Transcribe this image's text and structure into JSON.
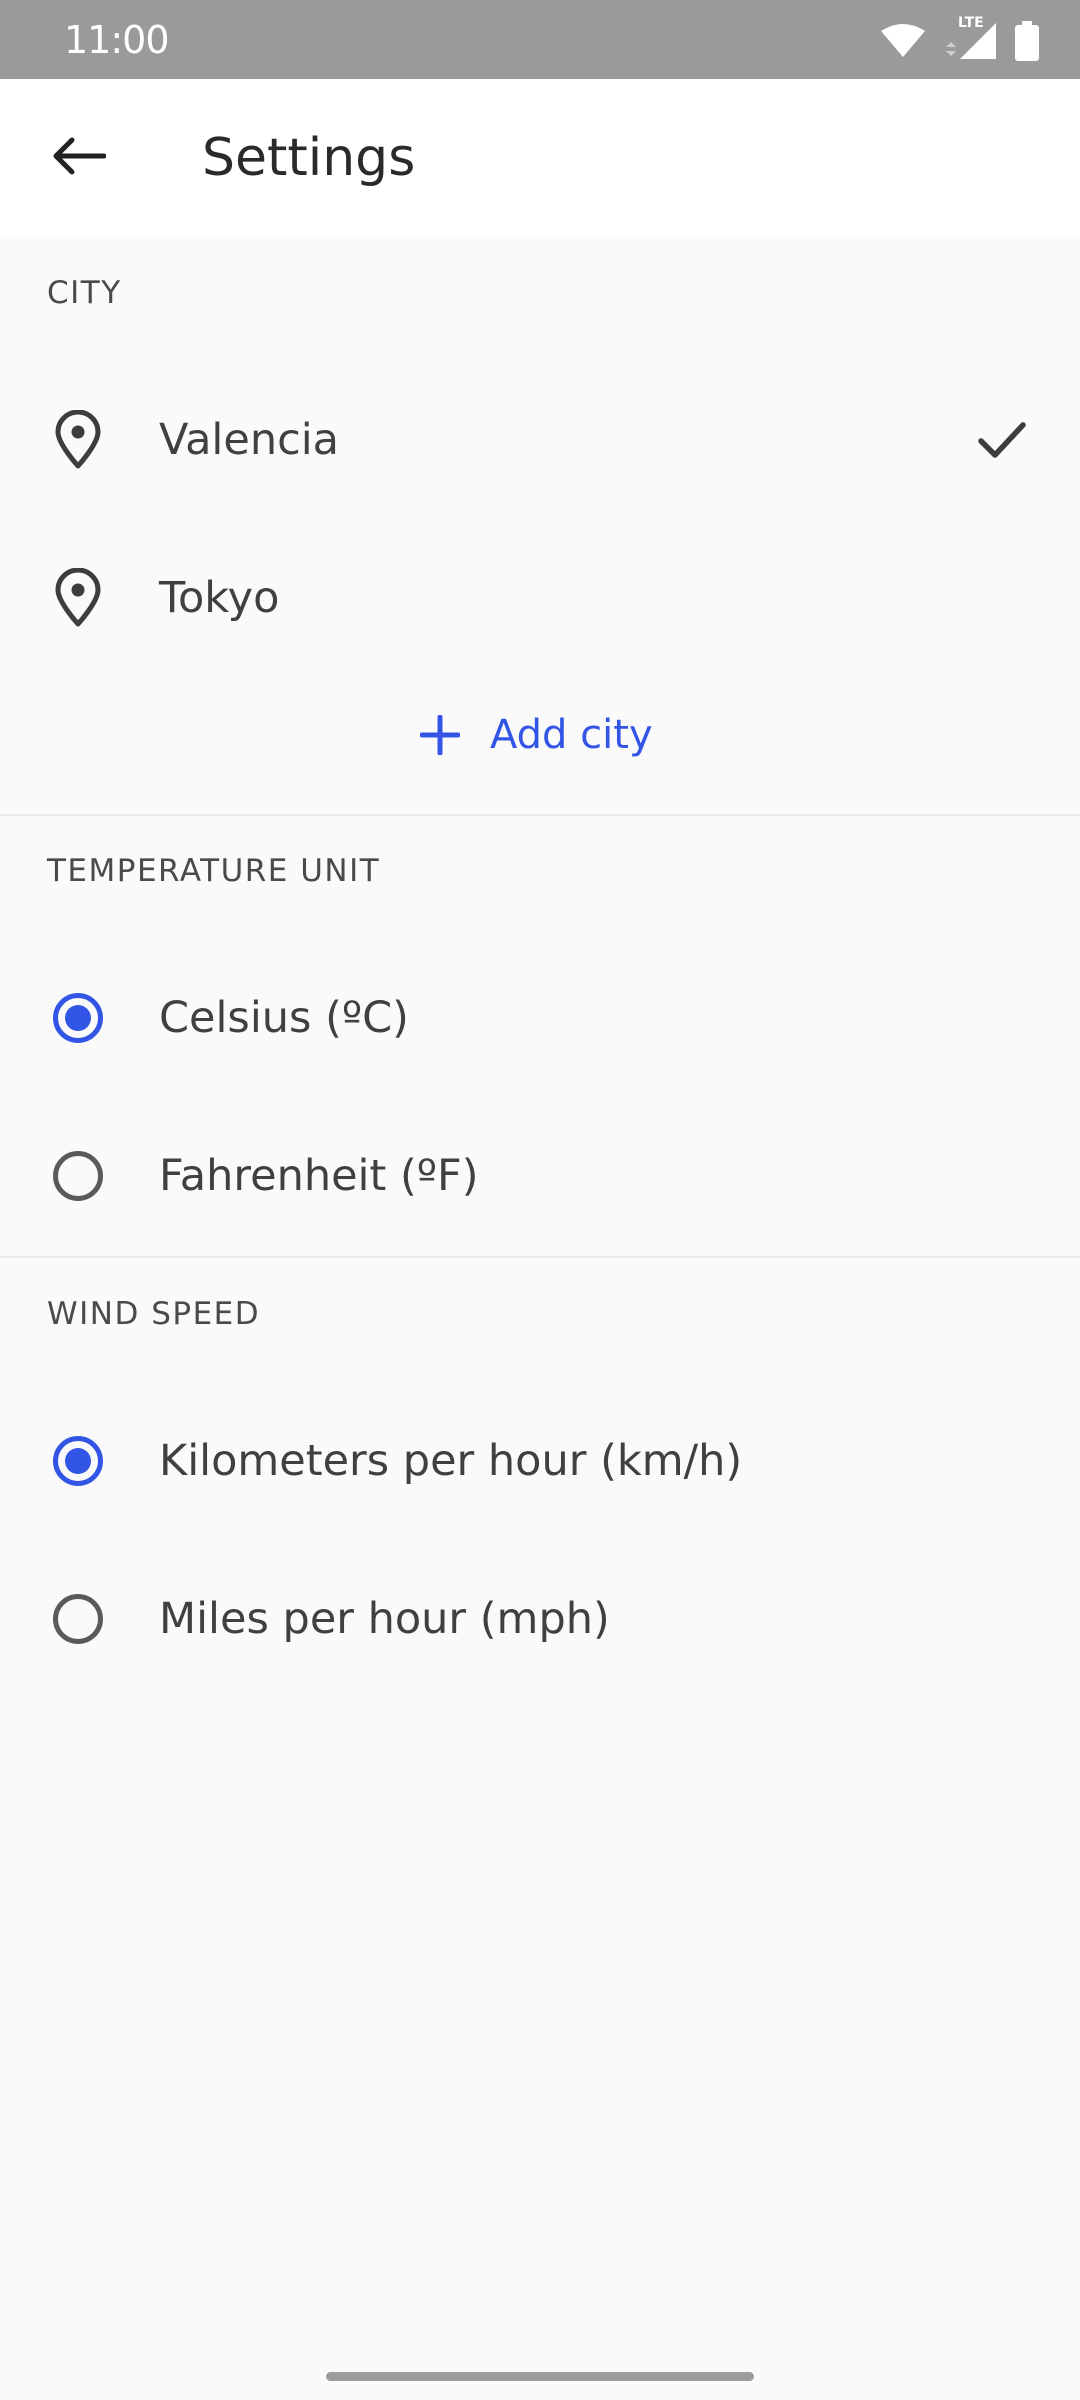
{
  "status_bar": {
    "time": "11:00",
    "network_label": "LTE",
    "icons": [
      "wifi-icon",
      "cellular-signal-icon",
      "battery-icon"
    ]
  },
  "header": {
    "title": "Settings",
    "back_icon": "arrow-back-icon"
  },
  "city": {
    "header": "CITY",
    "items": [
      {
        "label": "Valencia",
        "icon": "location-pin-icon",
        "selected": true
      },
      {
        "label": "Tokyo",
        "icon": "location-pin-icon",
        "selected": false
      }
    ],
    "add_label": "Add city",
    "add_icon": "plus-icon"
  },
  "temperature": {
    "header": "TEMPERATURE UNIT",
    "options": [
      {
        "label": "Celsius (ºC)",
        "selected": true
      },
      {
        "label": "Fahrenheit (ºF)",
        "selected": false
      }
    ]
  },
  "wind": {
    "header": "WIND SPEED",
    "options": [
      {
        "label": "Kilometers per hour (km/h)",
        "selected": true
      },
      {
        "label": "Miles per hour (mph)",
        "selected": false
      }
    ]
  },
  "colors": {
    "accent": "#3355e6",
    "status_bar": "#9a9a9a",
    "background": "#fafafa",
    "app_bar": "#ffffff"
  }
}
